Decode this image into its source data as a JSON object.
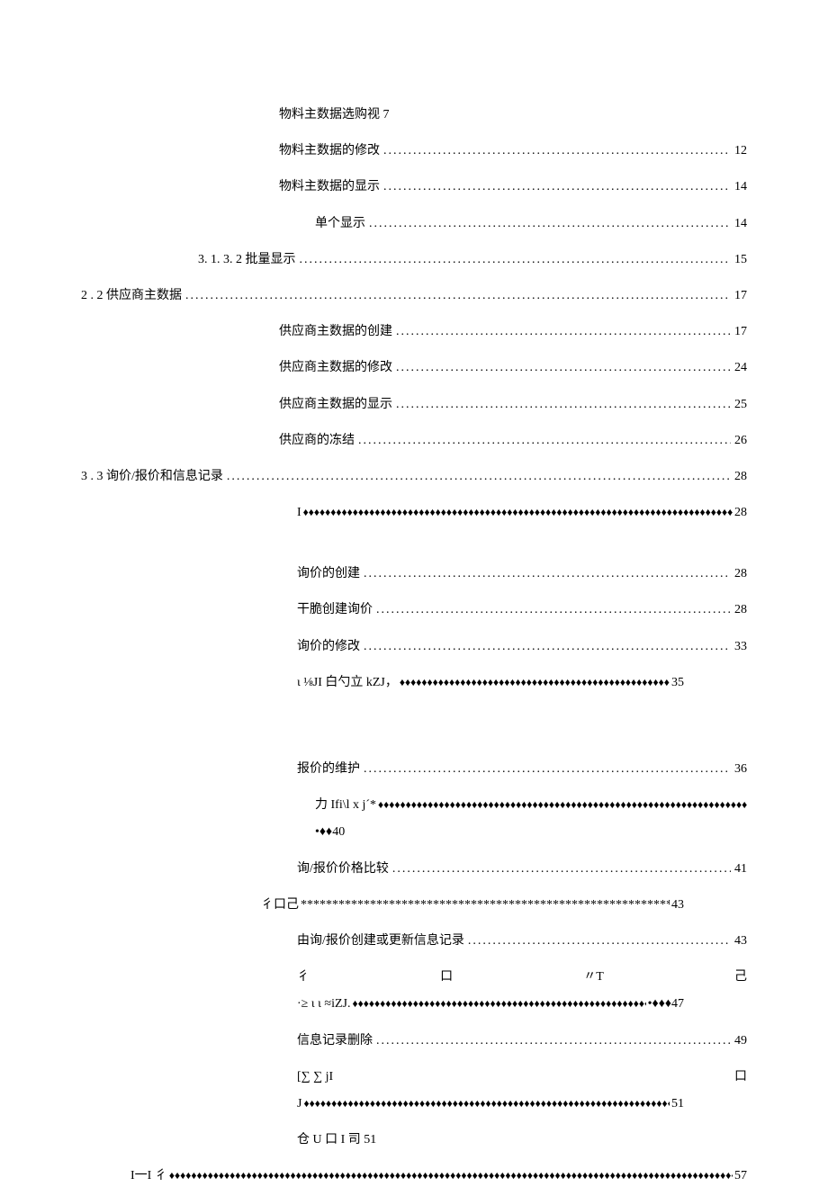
{
  "toc": {
    "line1": {
      "label": "物料主数据选购视 7"
    },
    "line2": {
      "label": "物料主数据的修改",
      "page": "12"
    },
    "line3": {
      "label": "物料主数据的显示",
      "page": "14"
    },
    "line4": {
      "label": "单个显示",
      "page": "14"
    },
    "line5": {
      "label": "3.  1. 3. 2 批量显示",
      "page": "15"
    },
    "line6": {
      "label": "2  . 2 供应商主数据",
      "page": "17"
    },
    "line7": {
      "label": "供应商主数据的创建",
      "page": "17"
    },
    "line8": {
      "label": "供应商主数据的修改",
      "page": "24"
    },
    "line9": {
      "label": "供应商主数据的显示",
      "page": "25"
    },
    "line10": {
      "label": "供应商的冻结",
      "page": "26"
    },
    "line11": {
      "label": "3  . 3 询价/报价和信息记录",
      "page": "28"
    },
    "line12": {
      "label": "I",
      "page": "28"
    },
    "line13": {
      "label": "询价的创建",
      "page": "28"
    },
    "line14": {
      "label": "干脆创建询价",
      "page": "28"
    },
    "line15": {
      "label": "询价的修改",
      "page": "33"
    },
    "line16": {
      "label": "ι ⅛JI 白勺立 kZJ，",
      "page": "35"
    },
    "line17": {
      "label": "报价的维护",
      "page": "36"
    },
    "line18": {
      "label_a": "力 Ifi\\l x j´*",
      "label_b": "•♦♦40"
    },
    "line19": {
      "label": "询/报价价格比较",
      "page": "41"
    },
    "line20": {
      "label": "彳口己",
      "page": "43"
    },
    "line21": {
      "label": "由询/报价创建或更新信息记录",
      "page": "43"
    },
    "line22": {
      "a": "彳",
      "b": "口",
      "c": "〃T",
      "d": "己"
    },
    "line23": {
      "label": "·≥ ι ι ≈iZJ.",
      "page": "47",
      "suffix": "•♦♦♦"
    },
    "line24": {
      "label": "信息记录删除",
      "page": "49"
    },
    "line25": {
      "a": " [∑ ∑ jI",
      "b": "口"
    },
    "line26": {
      "label": " J",
      "page": "51"
    },
    "line27": {
      "label": "仓 U 口 I 司 51"
    },
    "line28": {
      "label": "I一I 彳",
      "page": "57"
    }
  },
  "fillers": {
    "dots": "........................................................................................................................",
    "diamonds": "♦♦♦♦♦♦♦♦♦♦♦♦♦♦♦♦♦♦♦♦♦♦♦♦♦♦♦♦♦♦♦♦♦♦♦♦♦♦♦♦♦♦♦♦♦♦♦♦♦♦♦♦♦♦♦♦♦♦♦♦♦♦♦♦♦♦♦♦♦♦♦♦♦♦♦♦♦♦♦♦♦♦♦♦♦♦♦♦♦♦♦♦♦♦♦♦♦♦♦♦♦♦♦♦♦♦♦♦♦♦♦♦♦♦♦♦♦♦♦♦",
    "diamonds_dots_mix": "♦♦♦♦♦♦♦♦♦♦♦♦♦♦♦♦♦♦♦♦♦♦♦♦♦♦♦♦♦♦♦♦♦♦♦♦♦♦♦♦♦♦♦♦♦♦♦♦♦♦♦♦♦♦♦♦♦♦♦♦♦♦♦♦♦♦♦♦♦♦♦♦♦♦♦♦♦♦♦♦♦♦♦♦♦♦♦♦♦♦♦♦♦♦♦♦♦♦♦♦♦♦♦♦♦♦♦♦♦♦♦♦♦♦♦♦♦♦♦♦♦♦♦♦♦♦♦♦♦♦♦♦♦♦♦♦♦♦♦♦♦♦♦♦♦♦♦♦♦♦♦♦♦♦♦♦♦♦♦♦♦♦♦♦♦♦♦♦♦♦♦♦♦♦♦♦♦♦♦♦♦♦♦♦♦♦♦♦♦♦♦♦♦♦♦♦♦♦♦♦♦♦♦♦♦♦♦♦···  ·  ·",
    "stars": "*******************************************************************************************"
  }
}
